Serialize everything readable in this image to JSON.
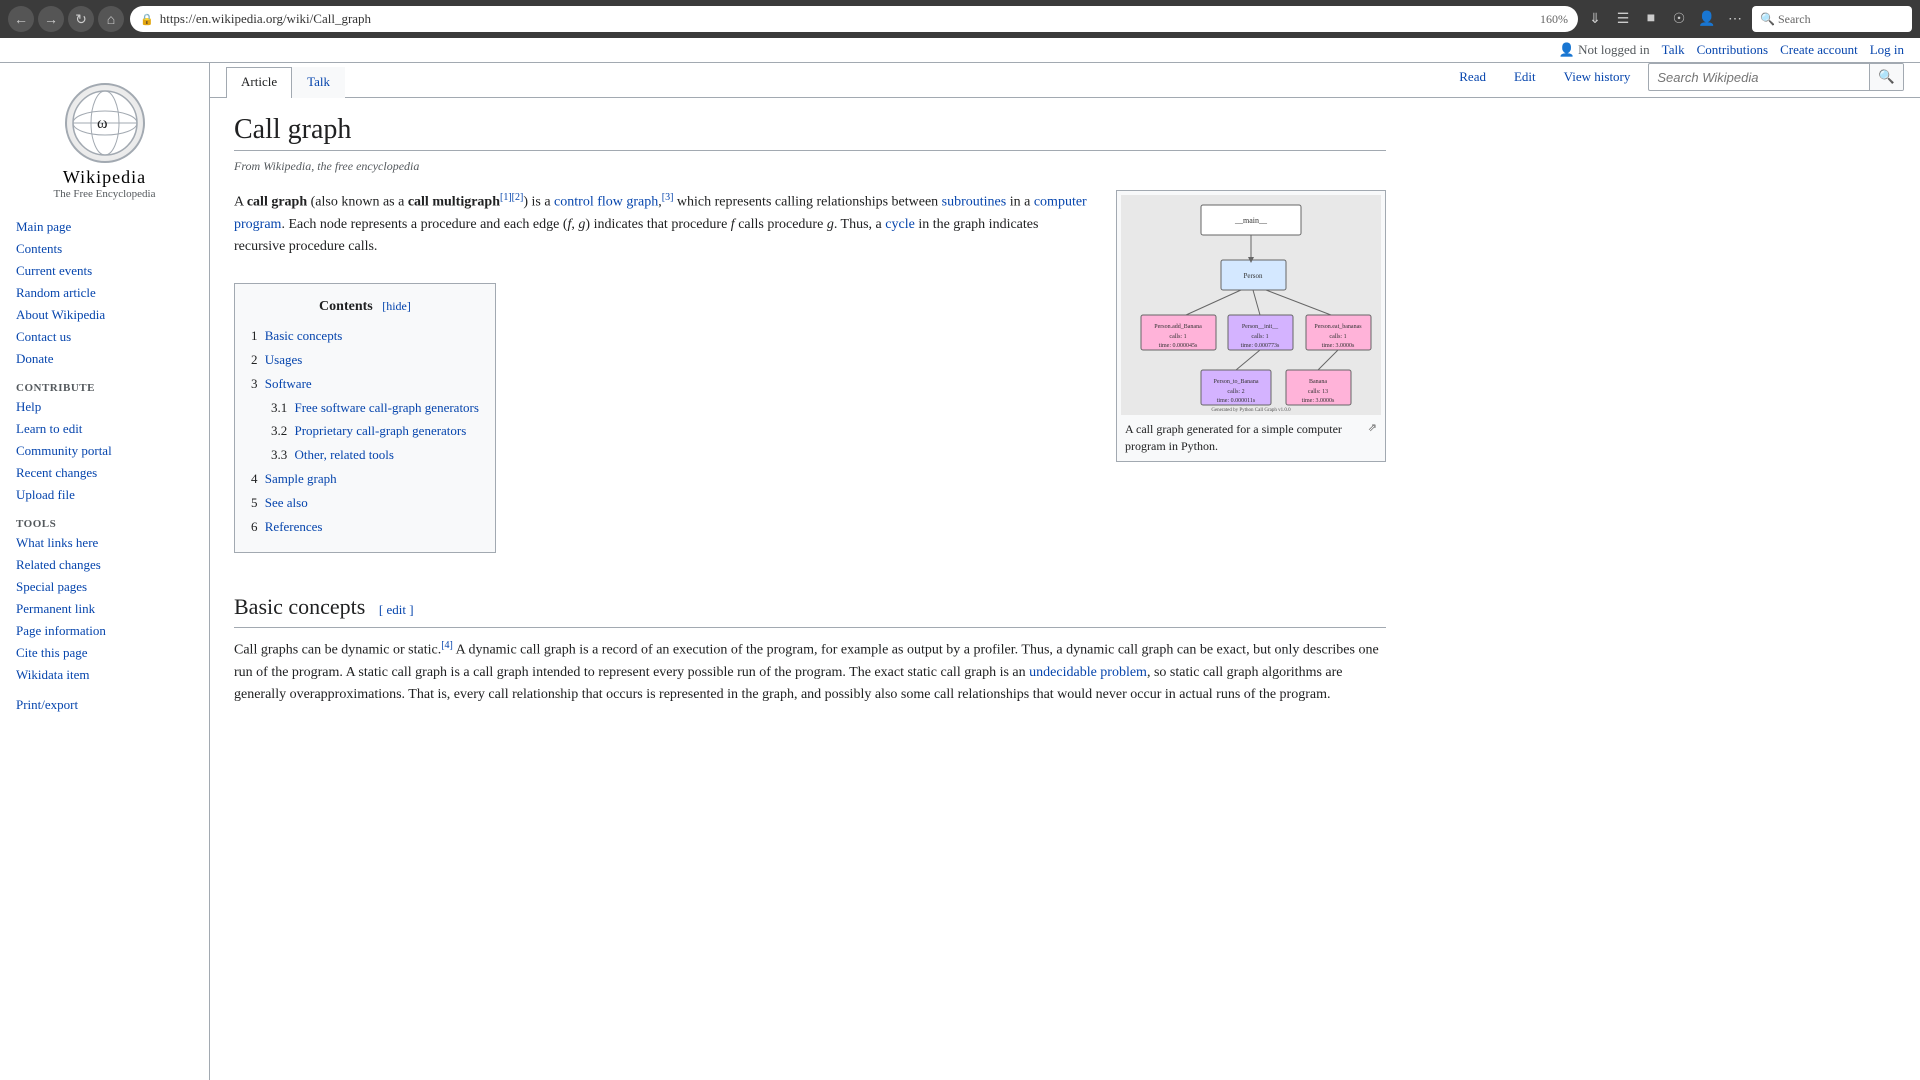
{
  "browser": {
    "url": "https://en.wikipedia.org/wiki/Call_graph",
    "zoom": "160%",
    "search_placeholder": "Search"
  },
  "header": {
    "not_logged": "Not logged in",
    "talk": "Talk",
    "contributions": "Contributions",
    "create_account": "Create account",
    "log_in": "Log in"
  },
  "sidebar": {
    "logo_title": "Wikipedia",
    "logo_sub": "The Free Encyclopedia",
    "nav_items": [
      {
        "label": "Main page"
      },
      {
        "label": "Contents"
      },
      {
        "label": "Current events"
      },
      {
        "label": "Random article"
      },
      {
        "label": "About Wikipedia"
      },
      {
        "label": "Contact us"
      },
      {
        "label": "Donate"
      }
    ],
    "contribute_title": "Contribute",
    "contribute_items": [
      {
        "label": "Help"
      },
      {
        "label": "Learn to edit"
      },
      {
        "label": "Community portal"
      },
      {
        "label": "Recent changes"
      },
      {
        "label": "Upload file"
      }
    ],
    "tools_title": "Tools",
    "tools_items": [
      {
        "label": "What links here"
      },
      {
        "label": "Related changes"
      },
      {
        "label": "Special pages"
      },
      {
        "label": "Permanent link"
      },
      {
        "label": "Page information"
      },
      {
        "label": "Cite this page"
      },
      {
        "label": "Wikidata item"
      }
    ],
    "print_section": "Print/export"
  },
  "tabs": {
    "article": "Article",
    "talk": "Talk",
    "read": "Read",
    "edit": "Edit",
    "view_history": "View history"
  },
  "search": {
    "placeholder": "Search Wikipedia"
  },
  "article": {
    "title": "Call graph",
    "from_wiki": "From Wikipedia, the free encyclopedia",
    "intro": "A call graph (also known as a call multigraph",
    "intro_refs": "[1][2]",
    "intro2": ") is a control flow graph,",
    "intro_ref3": "[3]",
    "intro3": " which represents calling relationships between subroutines in a computer program. Each node represents a procedure and each edge (f, g) indicates that procedure f calls procedure g. Thus, a cycle in the graph indicates recursive procedure calls.",
    "toc": {
      "title": "Contents",
      "hide": "hide",
      "items": [
        {
          "num": "1",
          "label": "Basic concepts"
        },
        {
          "num": "2",
          "label": "Usages"
        },
        {
          "num": "3",
          "label": "Software"
        },
        {
          "num": "3.1",
          "label": "Free software call-graph generators"
        },
        {
          "num": "3.2",
          "label": "Proprietary call-graph generators"
        },
        {
          "num": "3.3",
          "label": "Other, related tools"
        },
        {
          "num": "4",
          "label": "Sample graph"
        },
        {
          "num": "5",
          "label": "See also"
        },
        {
          "num": "6",
          "label": "References"
        }
      ]
    },
    "figure_caption": "A call graph generated for a simple computer program in Python.",
    "basic_concepts_heading": "Basic concepts",
    "edit_link": "edit",
    "basic_concepts_ref": "[4]",
    "basic_concepts_text": "Call graphs can be dynamic or static. A dynamic call graph is a record of an execution of the program, for example as output by a profiler. Thus, a dynamic call graph can be exact, but only describes one run of the program. A static call graph is a call graph intended to represent every possible run of the program. The exact static call graph is an undecidable problem, so static call graph algorithms are generally overapproximations. That is, every call relationship that occurs is represented in the graph, and possibly also some call relationships that would never occur in actual runs of the program."
  }
}
